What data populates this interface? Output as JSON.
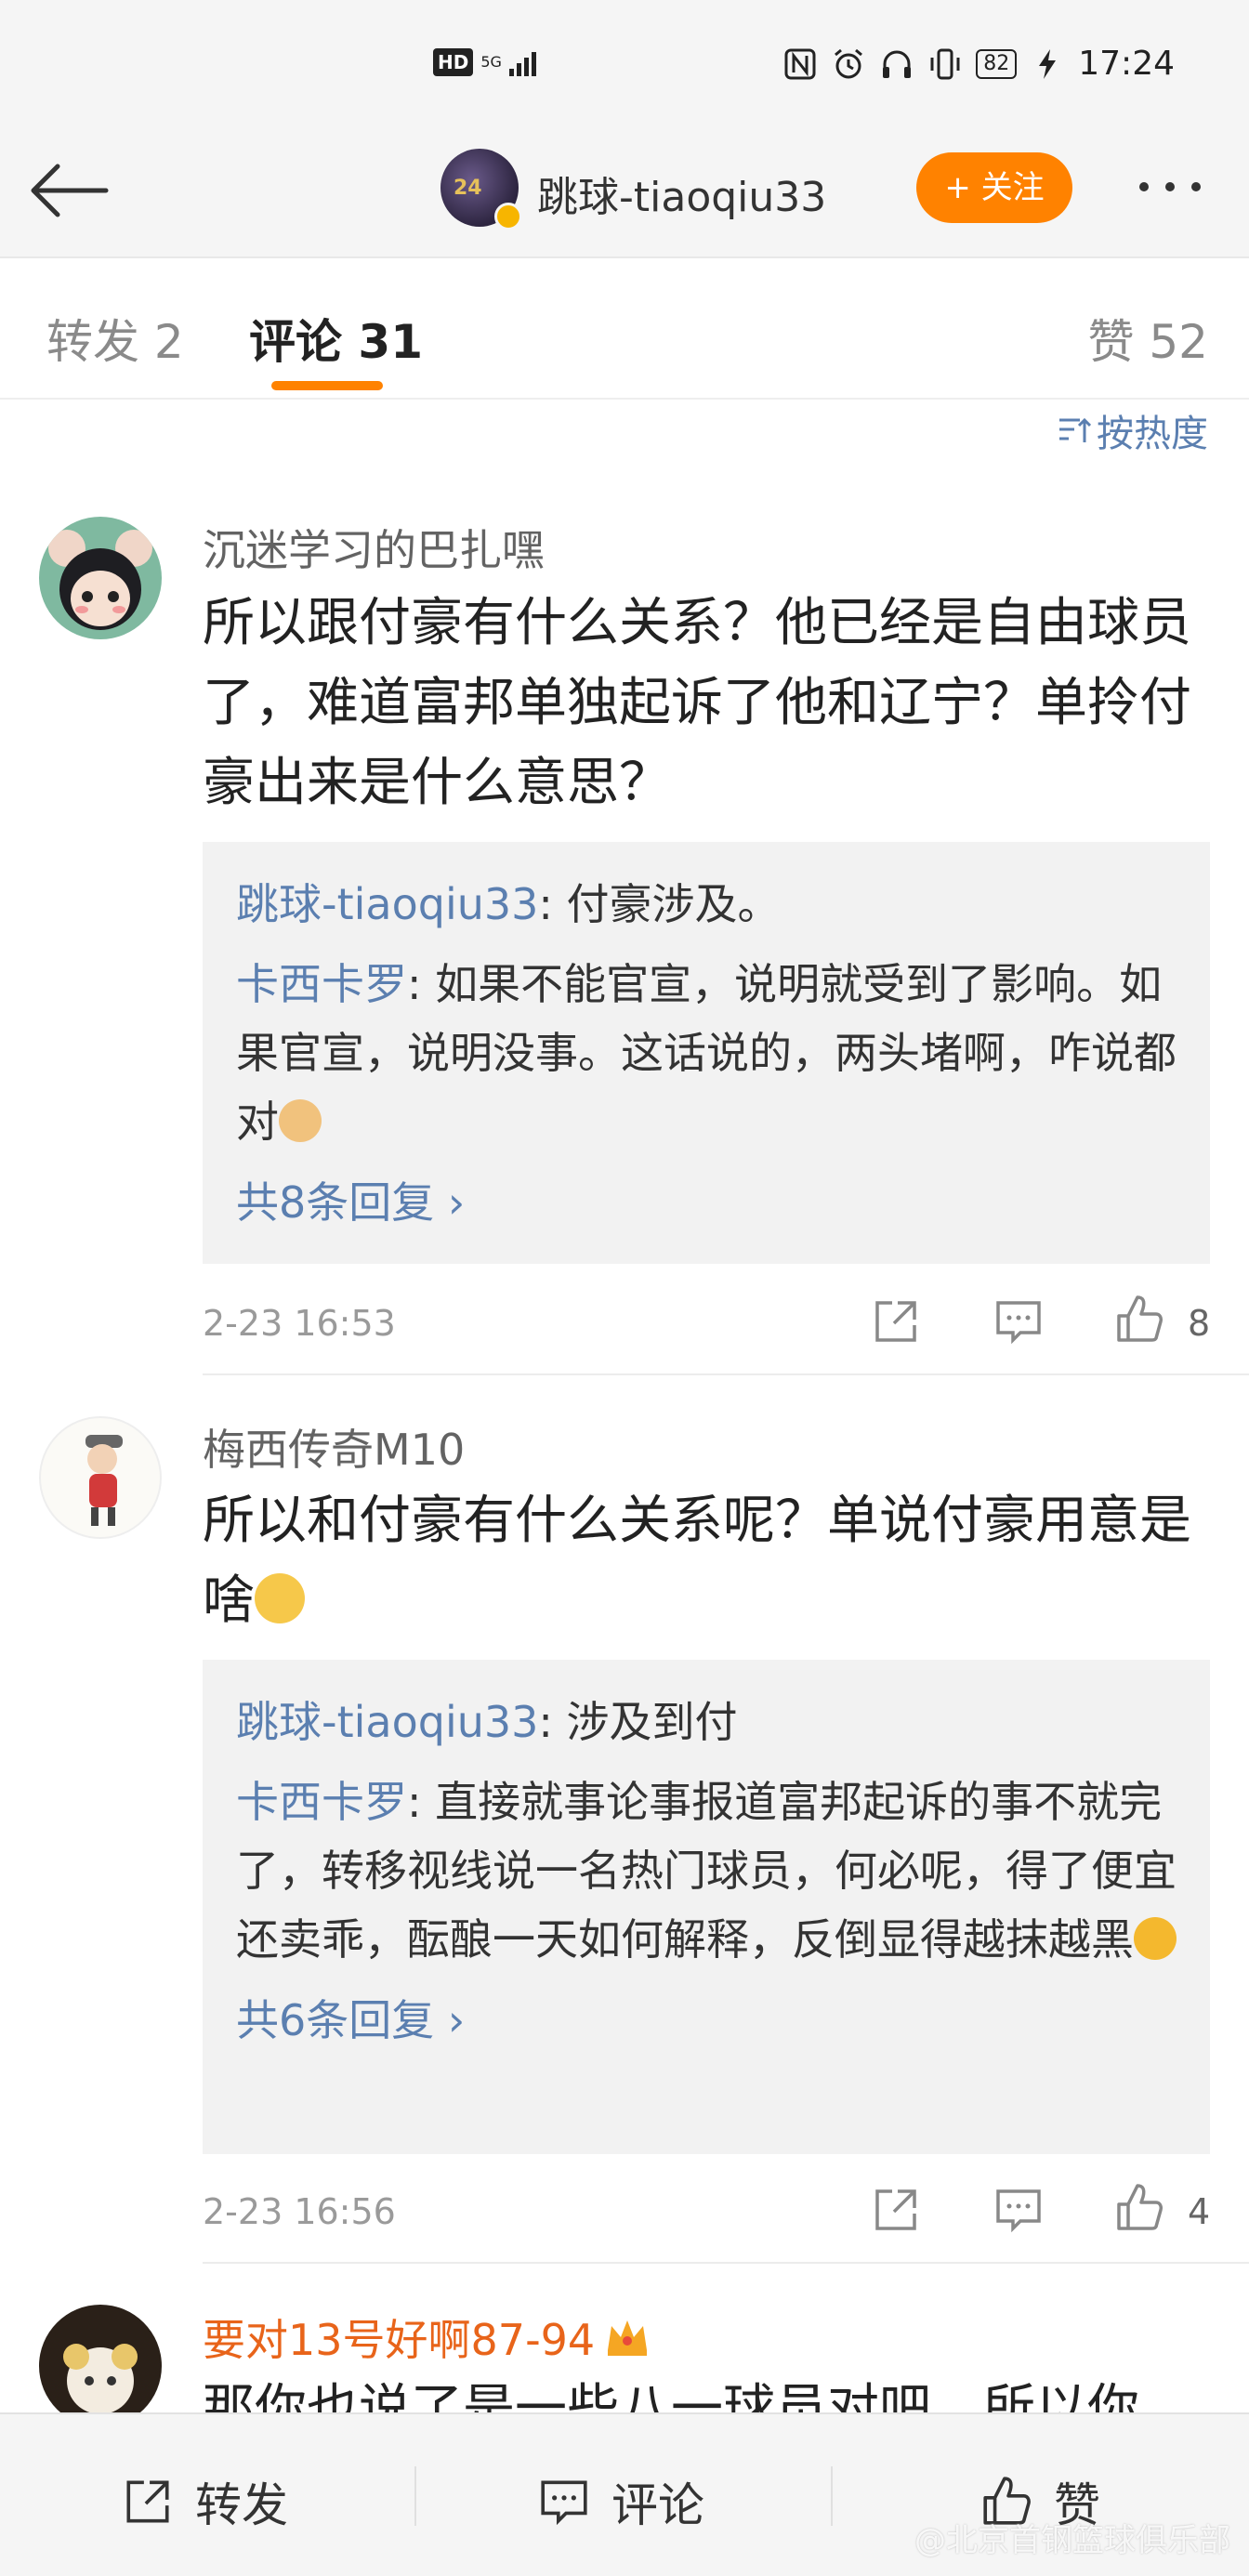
{
  "status_bar": {
    "hd": "HD",
    "network": "5G",
    "battery": "82",
    "time": "17:24"
  },
  "header": {
    "username": "跳球-tiaoqiu33",
    "follow_label": "+ 关注",
    "avatar_number": "24"
  },
  "tabs": [
    {
      "label": "转发 2"
    },
    {
      "label": "评论 31"
    },
    {
      "label": "赞 52"
    }
  ],
  "sort_label": "按热度",
  "comments": [
    {
      "username": "沉迷学习的巴扎嘿",
      "text": "所以跟付豪有什么关系？他已经是自由球员了，难道富邦单独起诉了他和辽宁？单拎付豪出来是什么意思？",
      "replies": [
        {
          "name": "跳球-tiaoqiu33",
          "text": ": 付豪涉及。"
        },
        {
          "name": "卡西卡罗",
          "text": ": 如果不能官宣，说明就受到了影响。如果官宣，说明没事。这话说的，两头堵啊，咋说都对"
        }
      ],
      "more_replies": "共8条回复 ›",
      "time": "2-23 16:53",
      "likes": "8"
    },
    {
      "username": "梅西传奇M10",
      "text": "所以和付豪有什么关系呢？单说付豪用意是啥",
      "replies": [
        {
          "name": "跳球-tiaoqiu33",
          "text": ": 涉及到付"
        },
        {
          "name": "卡西卡罗",
          "text": ": 直接就事论事报道富邦起诉的事不就完了，转移视线说一名热门球员，何必呢，得了便宜还卖乖，酝酿一天如何解释，反倒显得越抹越黑"
        }
      ],
      "more_replies": "共6条回复 ›",
      "time": "2-23 16:56",
      "likes": "4"
    },
    {
      "username": "要对13号好啊87-94",
      "text": "那你也说了是一些八一球员对吧，所以你"
    }
  ],
  "bottom_bar": {
    "repost": "转发",
    "comment": "评论",
    "like": "赞"
  },
  "watermark": "@北京首钢篮球俱乐部",
  "colors": {
    "accent": "#ff8200",
    "link": "#5b7fb0",
    "vip_name": "#e8641a"
  }
}
